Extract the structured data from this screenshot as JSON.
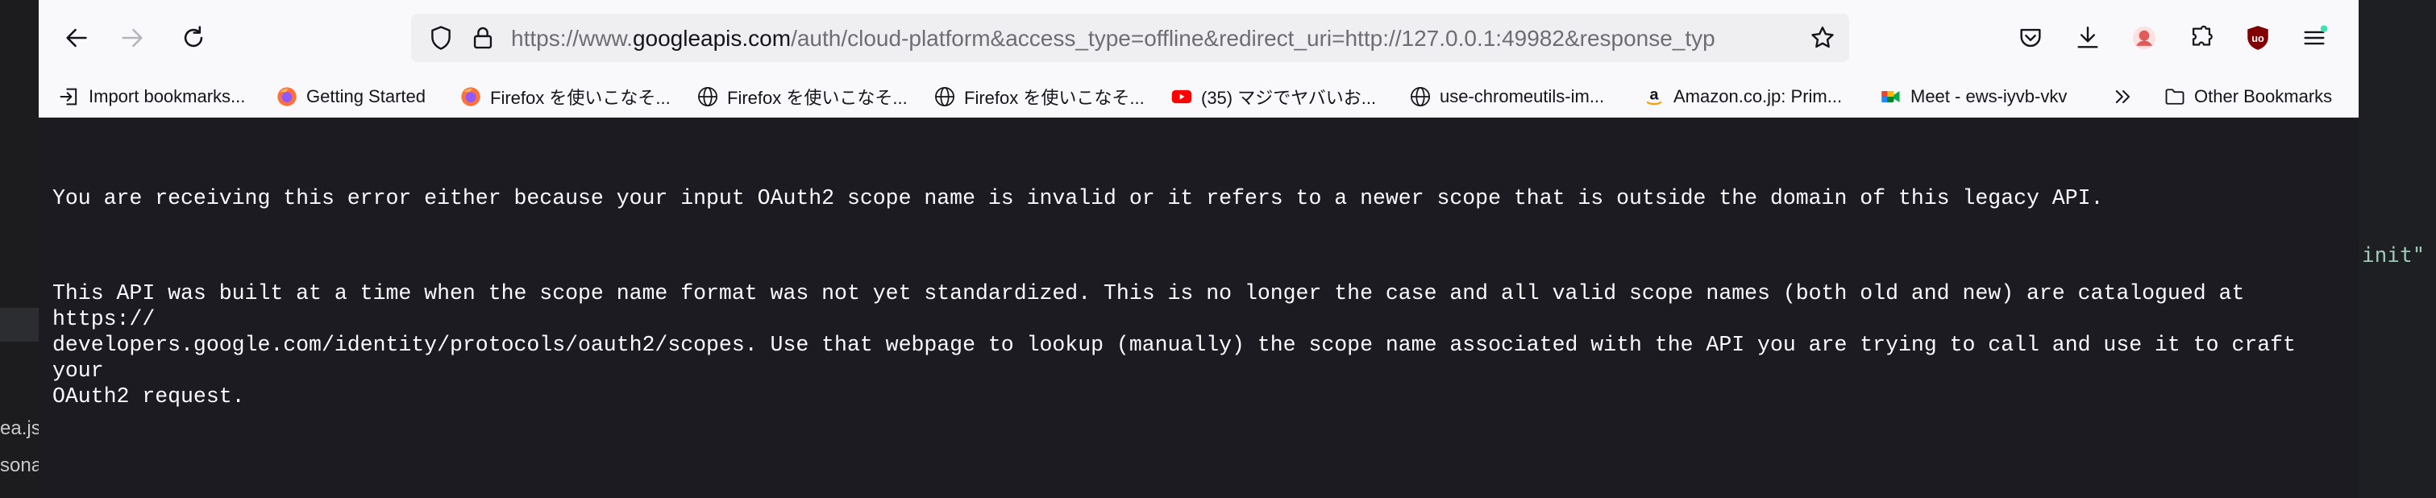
{
  "browser": {
    "url": {
      "scheme": "https://www.",
      "host": "googleapis.com",
      "path": "/auth/cloud-platform&access_type=offline&redirect_uri=http://127.0.0.1:49982&response_typ"
    }
  },
  "bookmarks": [
    {
      "label": "Import bookmarks...",
      "icon": "import-icon"
    },
    {
      "label": "Getting Started",
      "icon": "firefox-icon"
    },
    {
      "label": "Firefox を使いこなそ...",
      "icon": "firefox-icon"
    },
    {
      "label": "Firefox を使いこなそ...",
      "icon": "globe-icon"
    },
    {
      "label": "Firefox を使いこなそ...",
      "icon": "globe-icon"
    },
    {
      "label": "(35) マジでヤバいお...",
      "icon": "youtube-icon"
    },
    {
      "label": "use-chromeutils-im...",
      "icon": "globe-icon"
    },
    {
      "label": "Amazon.co.jp: Prim...",
      "icon": "amazon-icon"
    },
    {
      "label": "Meet - ews-iyvb-vkv",
      "icon": "meet-icon"
    },
    {
      "label": "Other Bookmarks",
      "icon": "folder-icon"
    }
  ],
  "content": {
    "paragraph1": "You are receiving this error either because your input OAuth2 scope name is invalid or it refers to a newer scope that is outside the domain of this legacy API.",
    "paragraph2": "This API was built at a time when the scope name format was not yet standardized. This is no longer the case and all valid scope names (both old and new) are catalogued at https://\ndevelopers.google.com/identity/protocols/oauth2/scopes. Use that webpage to lookup (manually) the scope name associated with the API you are trying to call and use it to craft your\nOAuth2 request."
  },
  "background": {
    "left_snippets": [
      "ea.jsc",
      "sona"
    ],
    "right_snippet": "init\""
  },
  "colors": {
    "toolbar": "#f9f9fb",
    "content_bg": "#1c1b22",
    "text": "#fbfbfe",
    "ublock_red": "#800000"
  }
}
